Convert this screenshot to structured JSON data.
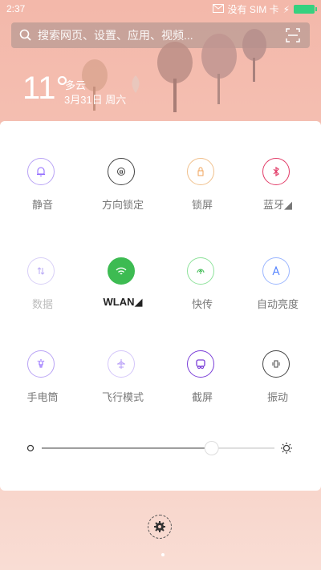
{
  "status": {
    "time": "2:37",
    "carrier": "没有 SIM 卡"
  },
  "search": {
    "placeholder": "搜索网页、设置、应用、视频..."
  },
  "weather": {
    "temperature": "11°",
    "condition": "多云",
    "date": "3月31日 周六"
  },
  "toggles": [
    {
      "label": "静音",
      "icon": "bell-icon",
      "color": "#8b62ff"
    },
    {
      "label": "方向锁定",
      "icon": "rotation-lock-icon",
      "color": "#444444"
    },
    {
      "label": "锁屏",
      "icon": "lock-icon",
      "color": "#f0a35a"
    },
    {
      "label": "蓝牙◢",
      "icon": "bluetooth-icon",
      "color": "#e23c68"
    },
    {
      "label": "数据",
      "icon": "data-icon",
      "color": "#b9a9f5"
    },
    {
      "label": "WLAN◢",
      "icon": "wifi-icon",
      "color": "#3dbb52"
    },
    {
      "label": "快传",
      "icon": "quick-share-icon",
      "color": "#3dbb52"
    },
    {
      "label": "自动亮度",
      "icon": "auto-brightness-icon",
      "color": "#4a7cff"
    },
    {
      "label": "手电筒",
      "icon": "flashlight-icon",
      "color": "#8b62ff"
    },
    {
      "label": "飞行模式",
      "icon": "airplane-icon",
      "color": "#b69bf7"
    },
    {
      "label": "截屏",
      "icon": "screenshot-icon",
      "color": "#7a3ed8"
    },
    {
      "label": "振动",
      "icon": "vibrate-icon",
      "color": "#444444"
    }
  ],
  "brightness": {
    "level": 0.73
  }
}
